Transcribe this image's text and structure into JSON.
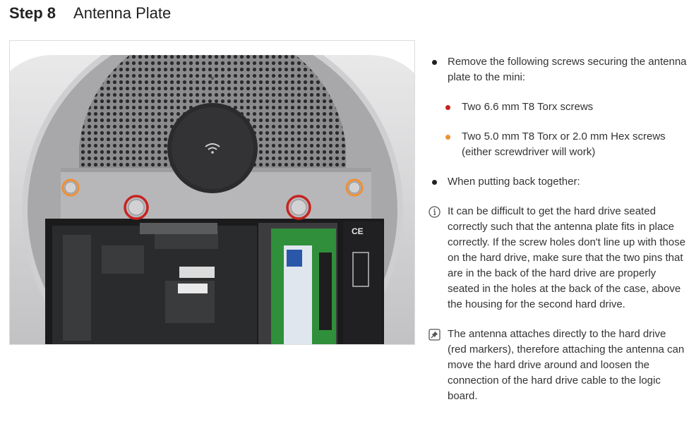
{
  "header": {
    "step_label": "Step 8",
    "title": "Antenna Plate"
  },
  "image": {
    "alt": "Mac mini underside with antenna plate screws marked",
    "ce_mark": "CE"
  },
  "instructions": [
    {
      "type": "bullet",
      "level": 0,
      "color": "black",
      "text": "Remove the following screws securing the antenna plate to the mini:"
    },
    {
      "type": "bullet",
      "level": 1,
      "color": "red",
      "color_hex": "#c8221f",
      "text": "Two 6.6 mm T8 Torx screws"
    },
    {
      "type": "bullet",
      "level": 1,
      "color": "orange",
      "color_hex": "#ef8f34",
      "text": "Two 5.0 mm T8 Torx or 2.0 mm Hex screws (either screwdriver will work)"
    },
    {
      "type": "bullet",
      "level": 0,
      "color": "black",
      "text": "When putting back together:"
    },
    {
      "type": "note",
      "icon": "info-icon",
      "text": "It can be difficult to get the hard drive seated correctly such that the antenna plate fits in place correctly. If the screw holes don't line up with those on the hard drive, make sure that the two pins that are in the back of the hard drive are properly seated in the holes at the back of the case, above the housing for the second hard drive."
    },
    {
      "type": "reminder",
      "icon": "pin-icon",
      "text": "The antenna attaches directly to the hard drive (red markers), therefore attaching the antenna can move the hard drive around and loosen the connection of the hard drive cable to the logic board."
    }
  ]
}
